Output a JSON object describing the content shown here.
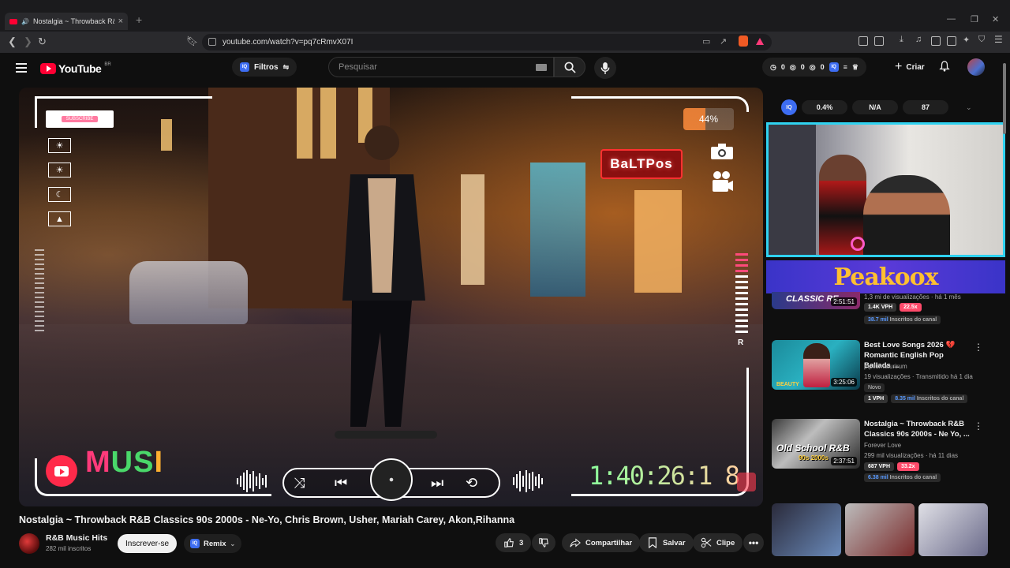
{
  "browser": {
    "tab_title": "Nostalgia ~ Throwback R&B",
    "url": "youtube.com/watch?v=pq7cRmvX07I"
  },
  "header": {
    "logo_text": "YouTube",
    "country_code": "BR",
    "filters_label": "Filtros",
    "search_placeholder": "Pesquisar",
    "stats": [
      "0",
      "0",
      "0"
    ],
    "create_label": "Criar"
  },
  "player": {
    "sign_text": "BaLTPos",
    "percent": "44%",
    "percent_value": 0.44,
    "r_label": "R",
    "music_text": "MUSI",
    "timecode": "1:40:26:1 8",
    "subscribe_mini": "SUBSCRIBE"
  },
  "video": {
    "title": "Nostalgia ~ Throwback R&B Classics 90s 2000s - Ne-Yo, Chris Brown, Usher, Mariah Carey, Akon,Rihanna",
    "channel_name": "R&B Music Hits",
    "channel_subs": "282 mil inscritos",
    "subscribe_label": "Inscrever-se",
    "remix_label": "Remix",
    "likes": "3",
    "share_label": "Compartilhar",
    "save_label": "Salvar",
    "clip_label": "Clipe"
  },
  "sidebar": {
    "iq_label": "IQ",
    "iq_values": [
      "0.4%",
      "N/A",
      "87"
    ],
    "banner_text": "Peakoox",
    "recommendations": [
      {
        "title": "",
        "thumb_text": "CLASSIC RE",
        "duration": "2:51:51",
        "meta1": "1,3 mi de visualizações · há 1 mês",
        "chips": [
          "1.4K VPH",
          "22.5x"
        ],
        "channel_subs": "38.7 mil",
        "subs_suffix": "Inscritos do canal"
      },
      {
        "title": "Best Love Songs 2026 💔 Romantic English Pop Ballads ...",
        "thumb_text": "BEAUTY",
        "duration": "3:25:06",
        "channel": "pipilumaturirum",
        "meta1": "19 visualizações · Transmitido há 1 dia",
        "badge": "Novo",
        "chips": [
          "1 VPH"
        ],
        "channel_subs": "8.35 mil",
        "subs_suffix": "Inscritos do canal"
      },
      {
        "title": "Nostalgia ~ Throwback R&B Classics 90s 2000s - Ne Yo, ...",
        "thumb_text": "Old School R&B",
        "thumb_sub": "90s 2000s",
        "duration": "2:37:51",
        "channel": "Forever Love",
        "meta1": "299 mil visualizações · há 11 dias",
        "chips": [
          "687 VPH",
          "33.2x"
        ],
        "channel_subs": "6.38 mil",
        "subs_suffix": "Inscritos do canal"
      }
    ]
  },
  "colors": {
    "youtube_red": "#ff0033",
    "iq_blue": "#3d6df2",
    "webcam_border": "#2fd2f0",
    "vph_chip": "#ff4a6a"
  }
}
